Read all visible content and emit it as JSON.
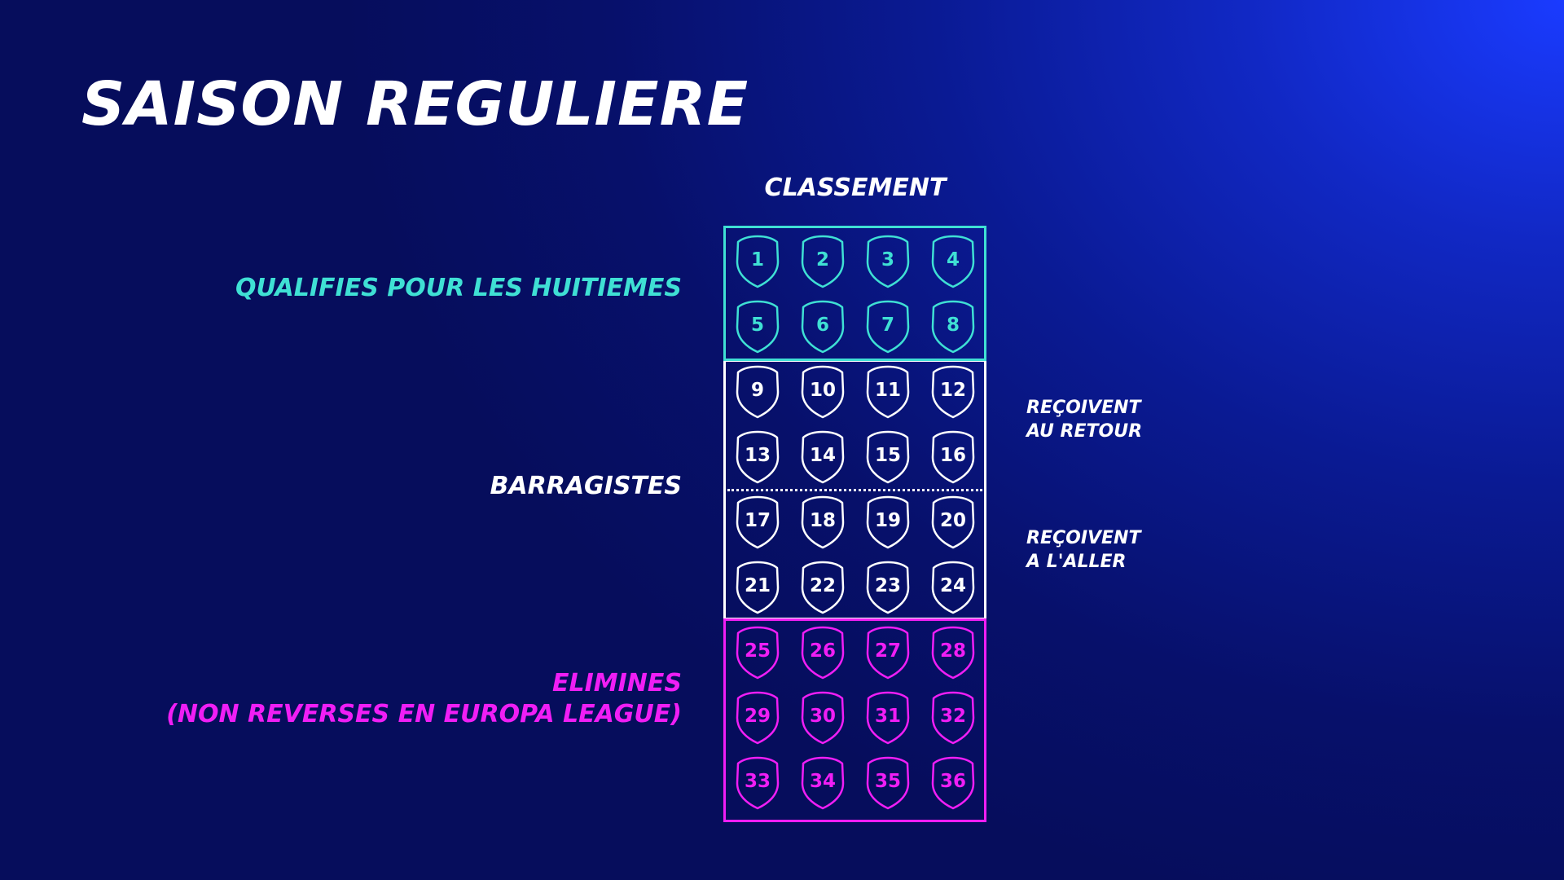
{
  "title": "SAISON REGULIERE",
  "column_header": "CLASSEMENT",
  "zones": {
    "qualified": {
      "label_lines": [
        "QUALIFIES POUR LES HUITIEMES"
      ],
      "color": "#3fe0d4",
      "positions": [
        1,
        2,
        3,
        4,
        5,
        6,
        7,
        8
      ]
    },
    "playoff": {
      "label_lines": [
        "BARRAGISTES"
      ],
      "color": "#ffffff",
      "positions": [
        9,
        10,
        11,
        12,
        13,
        14,
        15,
        16,
        17,
        18,
        19,
        20,
        21,
        22,
        23,
        24
      ]
    },
    "eliminated": {
      "label_lines": [
        "ELIMINES",
        "(NON REVERSES EN EUROPA LEAGUE)"
      ],
      "color": "#f01ef5",
      "positions": [
        25,
        26,
        27,
        28,
        29,
        30,
        31,
        32,
        33,
        34,
        35,
        36
      ]
    }
  },
  "notes": {
    "home_second_leg": [
      "REÇOIVENT",
      "AU RETOUR"
    ],
    "home_first_leg": [
      "REÇOIVENT",
      "A L'ALLER"
    ]
  },
  "icons": {
    "position_marker": "shield-icon"
  },
  "colors": {
    "background_dark": "#060d5c",
    "background_light": "#1a3bff"
  }
}
